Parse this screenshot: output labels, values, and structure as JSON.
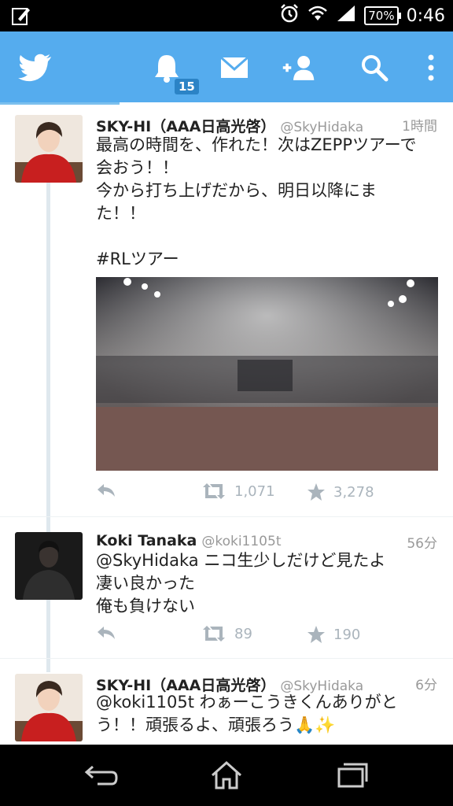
{
  "status_bar": {
    "battery": "70%",
    "clock": "0:46"
  },
  "app_bar": {
    "notification_count": "15"
  },
  "tweets": [
    {
      "name": "SKY-HI（AAA日高光啓）",
      "handle": "@SkyHidaka",
      "time": "1時間",
      "text": "最高の時間を、作れた！次はZEPPツアーで\n会おう！！\n今から打ち上げだから、明日以降にま\nた！！\n\n#RLツアー",
      "retweets": "1,071",
      "favorites": "3,278"
    },
    {
      "name": "Koki Tanaka",
      "handle": "@koki1105t",
      "time": "56分",
      "text": "@SkyHidaka ニコ生少しだけど見たよ\n凄い良かった\n俺も負けない",
      "retweets": "89",
      "favorites": "190"
    },
    {
      "name": "SKY-HI（AAA日高光啓）",
      "handle": "@SkyHidaka",
      "time": "6分",
      "text": "@koki1105t わぁーこうきくんありがと\nう！！頑張るよ、頑張ろう🙏✨"
    }
  ]
}
